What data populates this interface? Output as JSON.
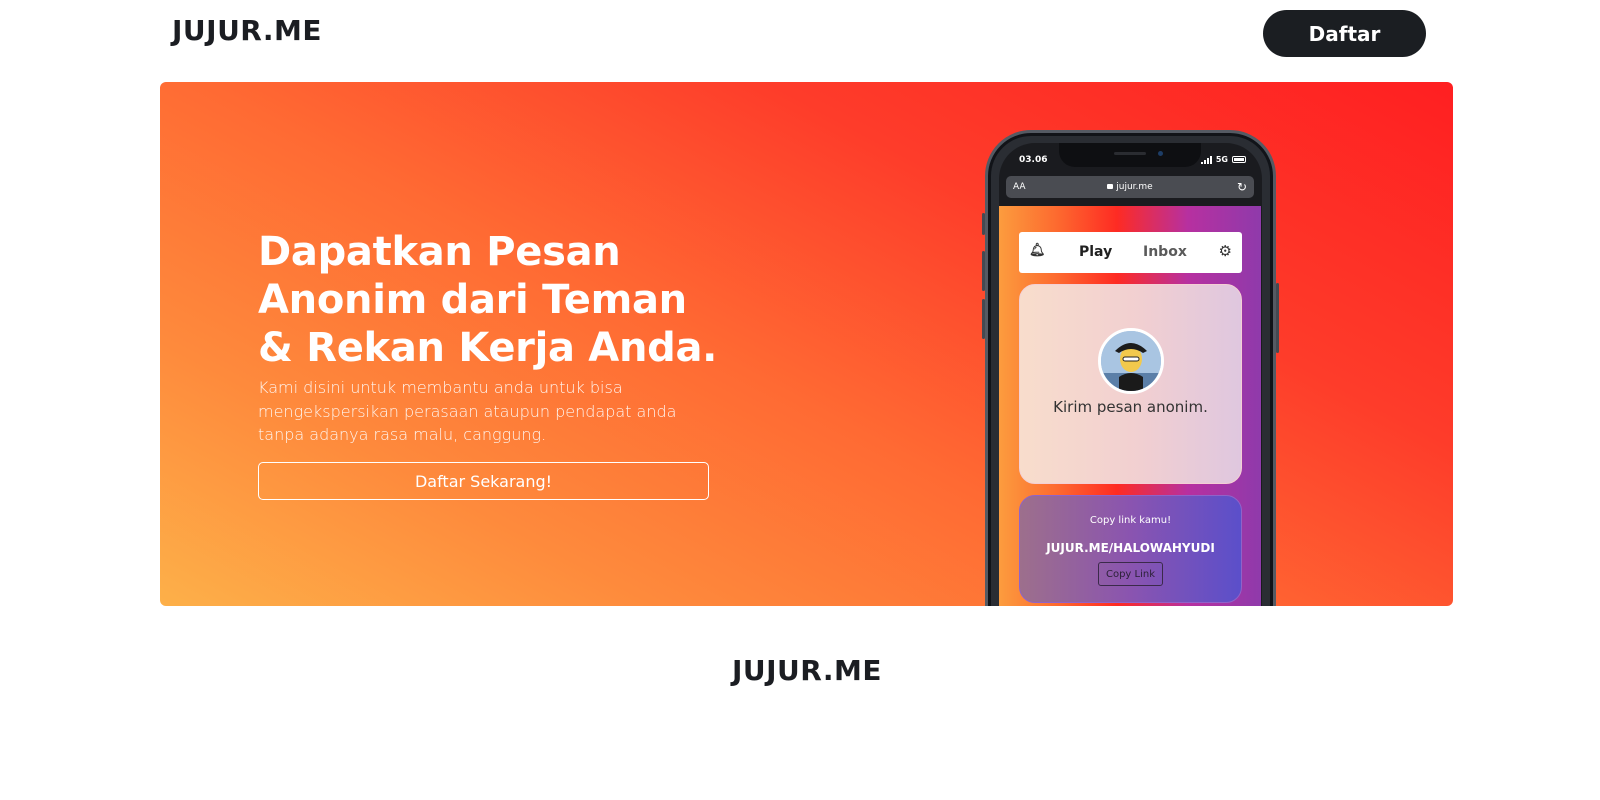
{
  "navbar": {
    "brand": "JUJUR.ME",
    "signup_label": "Daftar"
  },
  "hero": {
    "title": "Dapatkan Pesan Anonim dari Teman & Rekan Kerja Anda.",
    "subtitle": "Kami disini untuk membantu anda untuk bisa mengekspersikan perasaan ataupun pendapat anda tanpa adanya rasa malu, canggung.",
    "cta_label": "Daftar Sekarang!",
    "gradient_colors": [
      "#fdb049",
      "#ff6a33",
      "#ff1f21"
    ]
  },
  "phone": {
    "status_time": "03.06",
    "network": "5G",
    "url_aa": "AA",
    "url": "jujur.me",
    "app_nav": {
      "play_label": "Play",
      "inbox_label": "Inbox",
      "bell_icon": "bell-icon",
      "settings_icon": "gear-icon"
    },
    "send_card": {
      "text": "Kirim pesan anonim."
    },
    "link_card": {
      "label": "Copy link kamu!",
      "url": "JUJUR.ME/HALOWAHYUDI",
      "button_label": "Copy Link"
    }
  },
  "footer": {
    "brand": "JUJUR.ME"
  }
}
